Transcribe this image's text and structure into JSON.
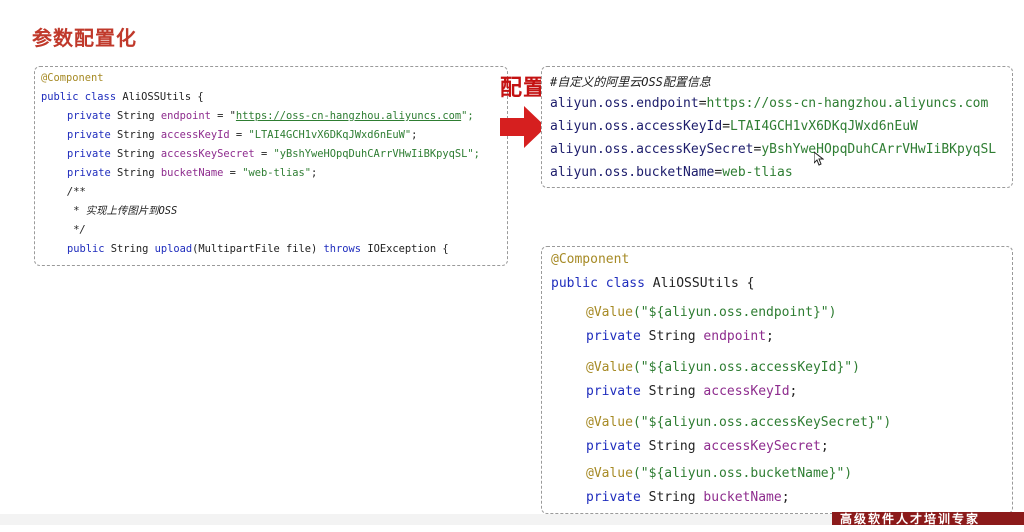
{
  "title": "参数配置化",
  "arrow_label": "配置",
  "left_code": {
    "l0": "@Component",
    "l1_kw": "public class ",
    "l1_name": "AliOSSUtils {",
    "l2_kw": "private ",
    "l2_type": "String ",
    "l2_fld": "endpoint",
    "l2_eq": " = \"",
    "l2_val": "https://oss-cn-hangzhou.aliyuncs.com",
    "l2_end": "\";",
    "l3_kw": "private ",
    "l3_type": "String ",
    "l3_fld": "accessKeyId",
    "l3_eq": " = ",
    "l3_val": "\"LTAI4GCH1vX6DKqJWxd6nEuW\"",
    "l3_end": ";",
    "l4_kw": "private ",
    "l4_type": "String ",
    "l4_fld": "accessKeySecret",
    "l4_eq": " = ",
    "l4_val": "\"yBshYweHOpqDuhCArrVHwIiBKpyqSL",
    "l4_end": "\";",
    "l5_kw": "private ",
    "l5_type": "String ",
    "l5_fld": "bucketName",
    "l5_eq": " = ",
    "l5_val": "\"web-tlias\"",
    "l5_end": ";",
    "l6": "/**",
    "l7": " * 实现上传图片到OSS",
    "l8": " */",
    "l9_kw": "public ",
    "l9_type": "String ",
    "l9_m": "upload",
    "l9_args": "(MultipartFile file) ",
    "l9_th": "throws ",
    "l9_ex": "IOException {"
  },
  "config": {
    "comment": "#自定义的阿里云OSS配置信息",
    "k1": "aliyun.oss.endpoint",
    "v1": "https://oss-cn-hangzhou.aliyuncs.com",
    "k2": "aliyun.oss.accessKeyId",
    "v2": "LTAI4GCH1vX6DKqJWxd6nEuW",
    "k3": "aliyun.oss.accessKeySecret",
    "v3": "yBshYweHOpqDuhCArrVHwIiBKpyqSL",
    "k4": "aliyun.oss.bucketName",
    "v4": "web-tlias",
    "eq": "="
  },
  "bottom_code": {
    "l0": "@Component",
    "l1_kw": "public class ",
    "l1_name": "AliOSSUtils {",
    "a1": "@Value",
    "a1v": "(\"${aliyun.oss.endpoint}\")",
    "f1_kw": "private ",
    "f1_type": "String ",
    "f1_fld": "endpoint",
    "f1_end": ";",
    "a2": "@Value",
    "a2v": "(\"${aliyun.oss.accessKeyId}\")",
    "f2_kw": "private ",
    "f2_type": "String ",
    "f2_fld": "accessKeyId",
    "f2_end": ";",
    "a3": "@Value",
    "a3v": "(\"${aliyun.oss.accessKeySecret}\")",
    "f3_kw": "private ",
    "f3_type": "String ",
    "f3_fld": "accessKeySecret",
    "f3_end": ";",
    "a4": "@Value",
    "a4v": "(\"${aliyun.oss.bucketName}\")",
    "f4_kw": "private ",
    "f4_type": "String ",
    "f4_fld": "bucketName",
    "f4_end": ";"
  },
  "footer_brand": "高级软件人才培训专家",
  "colors": {
    "title": "#c0392b",
    "arrow": "#d61f1f",
    "brand": "#8b1a1a"
  }
}
